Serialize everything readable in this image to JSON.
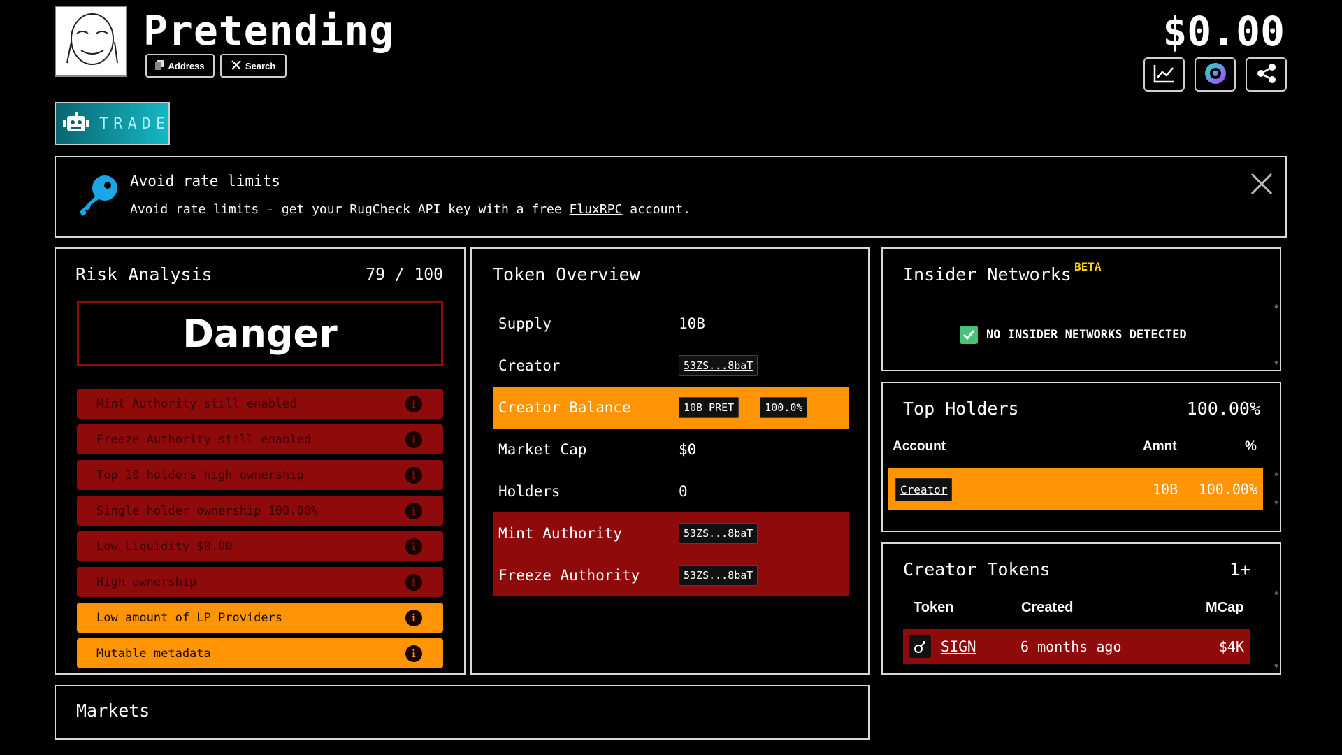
{
  "header": {
    "token_name": "Pretending",
    "address_label": "Address",
    "search_label": "Search",
    "price": "$0.00"
  },
  "trade": {
    "label": "TRADE"
  },
  "banner": {
    "title": "Avoid rate limits",
    "text_before": "Avoid rate limits - get your RugCheck API key with a free ",
    "link": "FluxRPC",
    "text_after": " account."
  },
  "risk": {
    "title": "Risk Analysis",
    "score": "79 / 100",
    "level": "Danger",
    "items": [
      {
        "label": "Mint Authority still enabled",
        "level": "danger"
      },
      {
        "label": "Freeze Authority still enabled",
        "level": "danger"
      },
      {
        "label": "Top 10 holders high ownership",
        "level": "danger"
      },
      {
        "label": "Single holder ownership 100.00%",
        "level": "danger"
      },
      {
        "label": "Low Liquidity $0.00",
        "level": "danger"
      },
      {
        "label": "High ownership",
        "level": "danger"
      },
      {
        "label": "Low amount of LP Providers",
        "level": "warn"
      },
      {
        "label": "Mutable metadata",
        "level": "warn"
      }
    ]
  },
  "overview": {
    "title": "Token Overview",
    "supply_label": "Supply",
    "supply": "10B",
    "creator_label": "Creator",
    "creator": "53ZS...8baT",
    "creator_balance_label": "Creator Balance",
    "creator_balance": "10B PRET",
    "creator_balance_pct": "100.0%",
    "market_cap_label": "Market Cap",
    "market_cap": "$0",
    "holders_label": "Holders",
    "holders": "0",
    "mint_label": "Mint Authority",
    "mint": "53ZS...8baT",
    "freeze_label": "Freeze Authority",
    "freeze": "53ZS...8baT"
  },
  "insider": {
    "title": "Insider Networks",
    "badge": "BETA",
    "status": "NO INSIDER NETWORKS DETECTED"
  },
  "top_holders": {
    "title": "Top Holders",
    "total_pct": "100.00%",
    "col_account": "Account",
    "col_amount": "Amnt",
    "col_pct": "%",
    "rows": [
      {
        "account": "Creator",
        "amount": "10B",
        "pct": "100.00%"
      }
    ]
  },
  "creator_tokens": {
    "title": "Creator Tokens",
    "count": "1+",
    "col_token": "Token",
    "col_created": "Created",
    "col_mcap": "MCap",
    "rows": [
      {
        "token": "SIGN",
        "created": "6 months ago",
        "mcap": "$4K"
      }
    ]
  },
  "markets": {
    "title": "Markets"
  },
  "colors": {
    "danger": "#8f0a0a",
    "warning": "#ff9405",
    "trade_accent": "#15b8c4",
    "beta": "#ffd200",
    "success": "#46c27a"
  }
}
